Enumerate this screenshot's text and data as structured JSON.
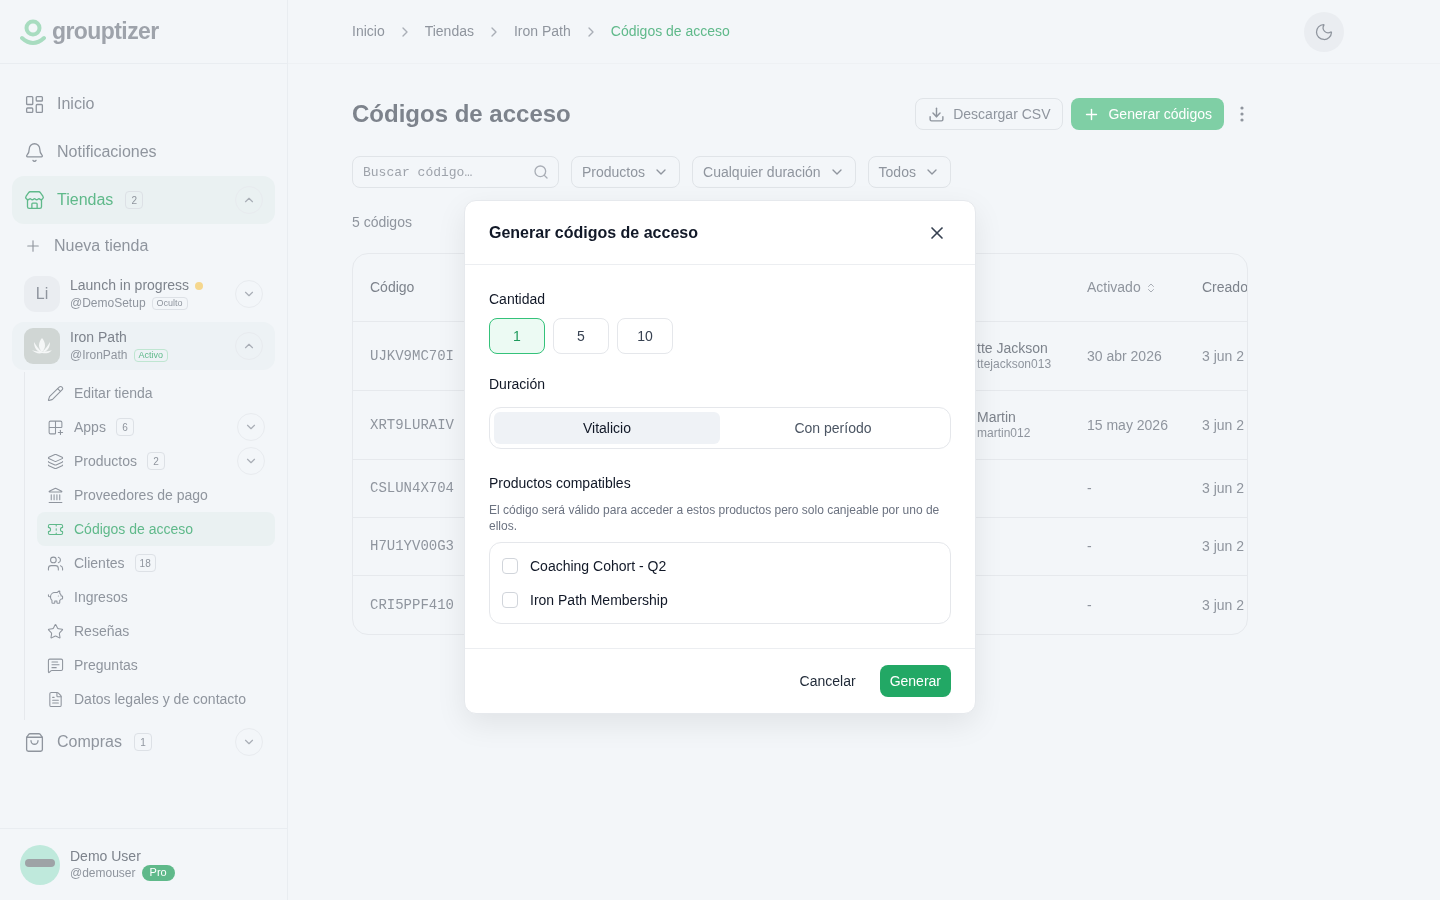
{
  "sidebar": {
    "logo": "grouptizer",
    "nav": [
      {
        "label": "Inicio",
        "selected": false
      },
      {
        "label": "Notificaciones",
        "selected": false
      }
    ],
    "stores_section": {
      "label": "Tiendas",
      "count": "2",
      "selected": true,
      "expanded": true
    },
    "new_store": "Nueva tienda",
    "stores": [
      {
        "initials": "Li",
        "name": "Launch in progress",
        "handle": "@DemoSetup",
        "badge": "Oculto",
        "active": false,
        "color": "#f5d78e",
        "expanded": false
      },
      {
        "name": "Iron Path",
        "handle": "@IronPath",
        "badge": "Activo",
        "active": true,
        "expanded": true,
        "submenu": [
          {
            "label": "Editar tienda",
            "selected": false
          },
          {
            "label": "Apps",
            "count": "6",
            "selected": false,
            "expanded": false
          },
          {
            "label": "Productos",
            "count": "2",
            "selected": false,
            "expanded": false
          },
          {
            "label": "Proveedores de pago",
            "selected": false
          },
          {
            "label": "Códigos de acceso",
            "selected": true
          },
          {
            "label": "Clientes",
            "count": "18",
            "selected": false
          },
          {
            "label": "Ingresos",
            "selected": false
          },
          {
            "label": "Reseñas",
            "selected": false
          },
          {
            "label": "Preguntas",
            "selected": false
          },
          {
            "label": "Datos legales y de contacto",
            "selected": false
          }
        ]
      }
    ],
    "purchases": {
      "label": "Compras",
      "count": "1",
      "expanded": false
    },
    "user": {
      "name": "Demo User",
      "handle": "@demouser",
      "badge": "Pro"
    }
  },
  "breadcrumbs": [
    {
      "label": "Inicio",
      "current": false
    },
    {
      "label": "Tiendas",
      "current": false
    },
    {
      "label": "Iron Path",
      "current": false
    },
    {
      "label": "Códigos de acceso",
      "current": true
    }
  ],
  "page": {
    "title": "Códigos de acceso",
    "download_button": "Descargar CSV",
    "generate_button": "Generar códigos",
    "search": {
      "placeholder": "Buscar código…"
    },
    "filters": [
      "Productos",
      "Cualquier duración",
      "Todos"
    ],
    "count": "5 códigos",
    "table": {
      "columns": [
        {
          "label": "Código",
          "sortable": false
        },
        {
          "label": "Activado",
          "sortable": true
        },
        {
          "label": "Creado",
          "sortable": false
        }
      ],
      "rows": [
        {
          "code": "UJKV9MC70I",
          "user_name": "tte Jackson",
          "user_handle": "ttejackson013",
          "activated": "30 abr 2026",
          "created": "3 jun 2"
        },
        {
          "code": "XRT9LURAIV",
          "user_name": "Martin",
          "user_handle": "martin012",
          "activated": "15 may 2026",
          "created": "3 jun 2"
        },
        {
          "code": "CSLUN4X704",
          "activated": "-",
          "created": "3 jun 2"
        },
        {
          "code": "H7U1YV00G3",
          "activated": "-",
          "created": "3 jun 2"
        },
        {
          "code": "CRI5PPF410",
          "activated": "-",
          "created": "3 jun 2"
        }
      ]
    }
  },
  "dialog": {
    "title": "Generar códigos de acceso",
    "quantity_label": "Cantidad",
    "quantities": [
      {
        "label": "1",
        "selected": true
      },
      {
        "label": "5",
        "selected": false
      },
      {
        "label": "10",
        "selected": false
      }
    ],
    "duration_label": "Duración",
    "durations": [
      {
        "label": "Vitalicio",
        "selected": true
      },
      {
        "label": "Con período",
        "selected": false
      }
    ],
    "products_label": "Productos compatibles",
    "products_hint": "El código será válido para acceder a estos productos pero solo canjeable por uno de ellos.",
    "products": [
      {
        "label": "Coaching Cohort - Q2",
        "checked": false
      },
      {
        "label": "Iron Path Membership",
        "checked": false
      }
    ],
    "cancel_button": "Cancelar",
    "submit_button": "Generar"
  }
}
